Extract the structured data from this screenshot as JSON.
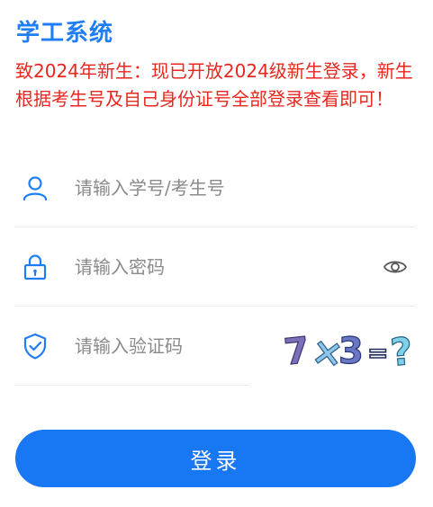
{
  "title": "学工系统",
  "notice": "致2024年新生：现已开放2024级新生登录，新生根据考生号及自己身份证号全部登录查看即可！",
  "username": {
    "placeholder": "请输入学号/考生号",
    "icon": "user-icon"
  },
  "password": {
    "placeholder": "请输入密码",
    "icon": "lock-icon",
    "toggle_icon": "eye-icon"
  },
  "captcha": {
    "placeholder": "请输入验证码",
    "icon": "shield-check-icon",
    "image_text": "7×3=?"
  },
  "login_button": "登录",
  "colors": {
    "brand": "#1f7ef5",
    "notice": "#e8271f",
    "button": "#1877f2"
  }
}
